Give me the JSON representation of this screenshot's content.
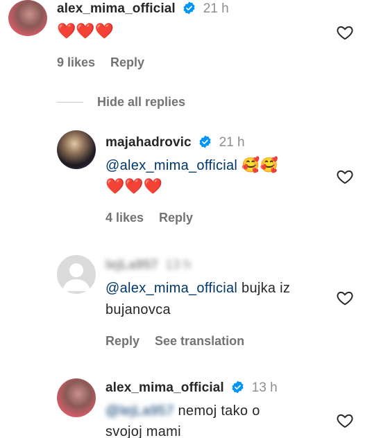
{
  "comments": [
    {
      "username": "alex_mima_official",
      "time": "21 h",
      "text": "❤️❤️❤️",
      "likes": "9 likes",
      "reply": "Reply"
    },
    {
      "username": "majahadrovic",
      "time": "21 h",
      "mention": "@alex_mima_official",
      "emoji": "🥰🥰",
      "text": "❤️❤️❤️",
      "likes": "4 likes",
      "reply": "Reply"
    },
    {
      "username": "lejLa957",
      "time": "13 h",
      "mention": "@alex_mima_official",
      "text_line1": "bujka iz",
      "text_line2": "bujanovca",
      "reply": "Reply",
      "translate": "See translation"
    },
    {
      "username": "alex_mima_official",
      "time": "13 h",
      "mention": "@lejLa957",
      "text_line1": "nemoj tako o",
      "text_line2": "svojoj mami"
    }
  ],
  "hide_replies": "Hide all replies",
  "colors": {
    "verified": "#0095f6",
    "mention": "#00376b",
    "meta": "#737373",
    "heart_red": "#e0202c"
  }
}
